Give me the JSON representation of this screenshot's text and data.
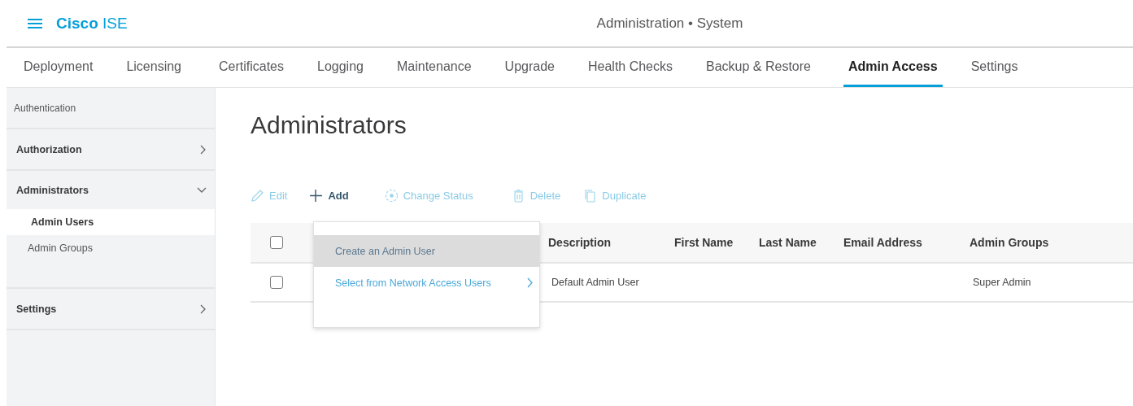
{
  "header": {
    "brand_bold": "Cisco",
    "brand_light": "ISE",
    "title": "Administration • System"
  },
  "tabs": [
    {
      "label": "Deployment",
      "selected": false
    },
    {
      "label": "Licensing",
      "selected": false
    },
    {
      "label": "Certificates",
      "selected": false
    },
    {
      "label": "Logging",
      "selected": false
    },
    {
      "label": "Maintenance",
      "selected": false
    },
    {
      "label": "Upgrade",
      "selected": false
    },
    {
      "label": "Health Checks",
      "selected": false
    },
    {
      "label": "Backup & Restore",
      "selected": false
    },
    {
      "label": "Admin Access",
      "selected": true
    },
    {
      "label": "Settings",
      "selected": false
    }
  ],
  "sidebar": {
    "items": [
      {
        "label": "Authentication",
        "kind": "plain"
      },
      {
        "label": "Authorization",
        "kind": "group",
        "expanded": false
      },
      {
        "label": "Administrators",
        "kind": "group",
        "expanded": true,
        "children": [
          {
            "label": "Admin Users",
            "selected": true
          },
          {
            "label": "Admin Groups",
            "selected": false
          }
        ]
      },
      {
        "label": "Settings",
        "kind": "group",
        "expanded": false
      }
    ]
  },
  "page_title": "Administrators",
  "toolbar": [
    {
      "label": "Edit",
      "kind": "edit",
      "disabled": true
    },
    {
      "label": "Add",
      "kind": "add",
      "disabled": false
    },
    {
      "label": "Change Status",
      "kind": "status",
      "disabled": true
    },
    {
      "label": "Delete",
      "kind": "delete",
      "disabled": true
    },
    {
      "label": "Duplicate",
      "kind": "duplicate",
      "disabled": true
    }
  ],
  "table": {
    "columns": [
      "Description",
      "First Name",
      "Last Name",
      "Email Address",
      "Admin Groups"
    ],
    "header_checked": false,
    "rows": [
      {
        "checked": false,
        "cells": [
          "Default Admin User",
          "",
          "",
          "",
          "Super Admin"
        ]
      }
    ]
  },
  "add_menu": {
    "items": [
      {
        "label": "Create an Admin User",
        "selected": true,
        "submenu": false
      },
      {
        "label": "Select from Network Access Users",
        "selected": false,
        "submenu": true
      }
    ]
  }
}
